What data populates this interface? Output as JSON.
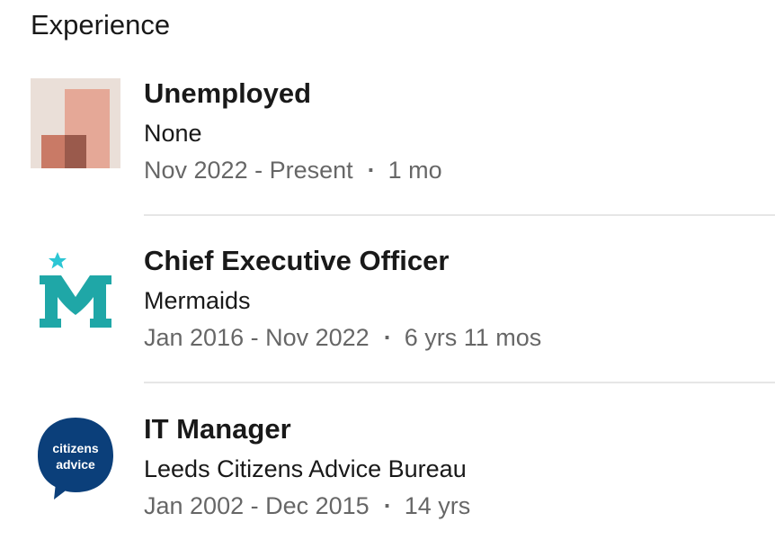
{
  "section": {
    "title": "Experience"
  },
  "experiences": [
    {
      "title": "Unemployed",
      "company": "None",
      "date_range": "Nov 2022 - Present",
      "separator": "·",
      "duration": "1 mo",
      "logo_icon": "abstract-blocks-logo",
      "logo_colors": [
        "#eadfd8",
        "#e5a897",
        "#c97a66",
        "#9a5a4c"
      ]
    },
    {
      "title": "Chief Executive Officer",
      "company": "Mermaids",
      "date_range": "Jan 2016 - Nov 2022",
      "separator": "·",
      "duration": "6 yrs 11 mos",
      "logo_icon": "mermaids-m-star-logo",
      "logo_colors": [
        "#1fa7a7",
        "#2cc6d4"
      ]
    },
    {
      "title": "IT Manager",
      "company": "Leeds Citizens Advice Bureau",
      "date_range": "Jan 2002 - Dec 2015",
      "separator": "·",
      "duration": "14 yrs",
      "logo_icon": "citizens-advice-logo",
      "logo_text": [
        "citizens",
        "advice"
      ],
      "logo_colors": [
        "#0b3f7a",
        "#ffffff"
      ]
    }
  ]
}
